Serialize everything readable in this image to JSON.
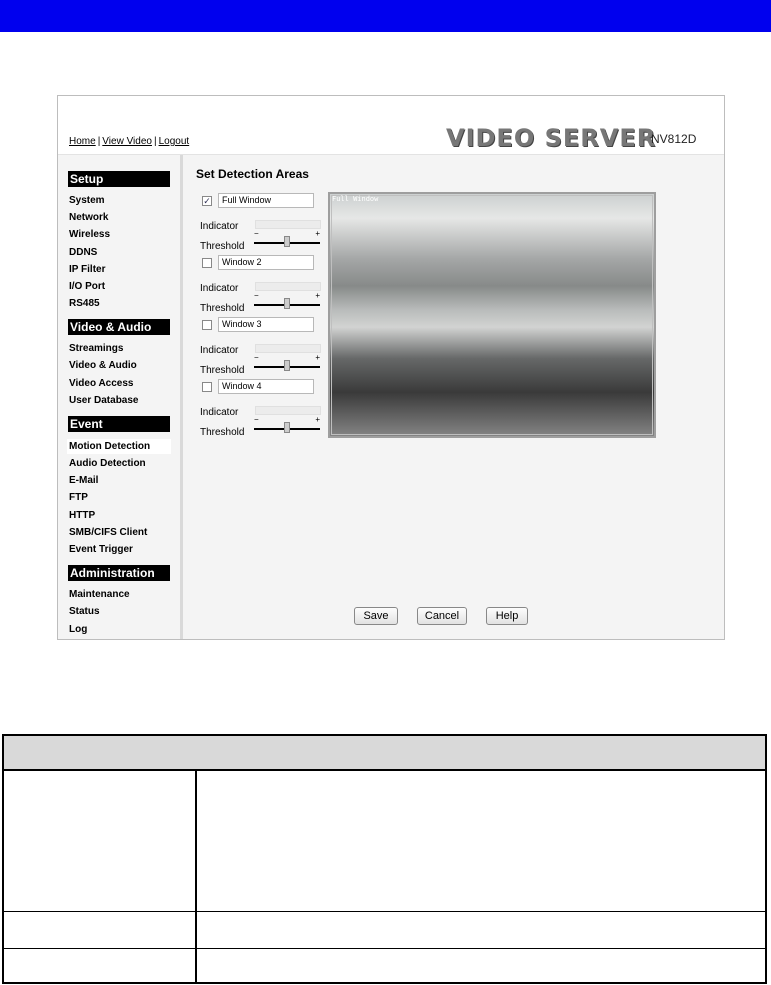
{
  "nav_links": {
    "home": "Home",
    "view_video": "View Video",
    "logout": "Logout",
    "separator": "|"
  },
  "brand": {
    "title": "VIDEO SERVER",
    "model": "NV812D"
  },
  "sidebar": {
    "setup": {
      "title": "Setup",
      "items": [
        "System",
        "Network",
        "Wireless",
        "DDNS",
        "IP Filter",
        "I/O Port",
        "RS485"
      ]
    },
    "video_audio": {
      "title": "Video & Audio",
      "items": [
        "Streamings",
        "Video & Audio",
        "Video Access",
        "User Database"
      ]
    },
    "event": {
      "title": "Event",
      "items": [
        "Motion Detection",
        "Audio Detection",
        "E-Mail",
        "FTP",
        "HTTP",
        "SMB/CIFS Client",
        "Event Trigger"
      ]
    },
    "administration": {
      "title": "Administration",
      "items": [
        "Maintenance",
        "Status",
        "Log"
      ]
    },
    "active_item": "Motion Detection"
  },
  "main": {
    "title": "Set Detection Areas",
    "indicator_label": "Indicator",
    "threshold_label": "Threshold",
    "slider_minus": "−",
    "slider_plus": "+",
    "windows": [
      {
        "name": "Full Window",
        "checked": true,
        "threshold": 0.5
      },
      {
        "name": "Window 2",
        "checked": false,
        "threshold": 0.5
      },
      {
        "name": "Window 3",
        "checked": false,
        "threshold": 0.5
      },
      {
        "name": "Window 4",
        "checked": false,
        "threshold": 0.5
      }
    ],
    "video_label": "Full Window",
    "buttons": {
      "save": "Save",
      "cancel": "Cancel",
      "help": "Help"
    }
  },
  "colors": {
    "topbar": "#0000ee",
    "section_bg": "#000000",
    "panel_bg": "#f4f4f4"
  },
  "icons": {
    "checkbox_checked": "check-icon"
  }
}
